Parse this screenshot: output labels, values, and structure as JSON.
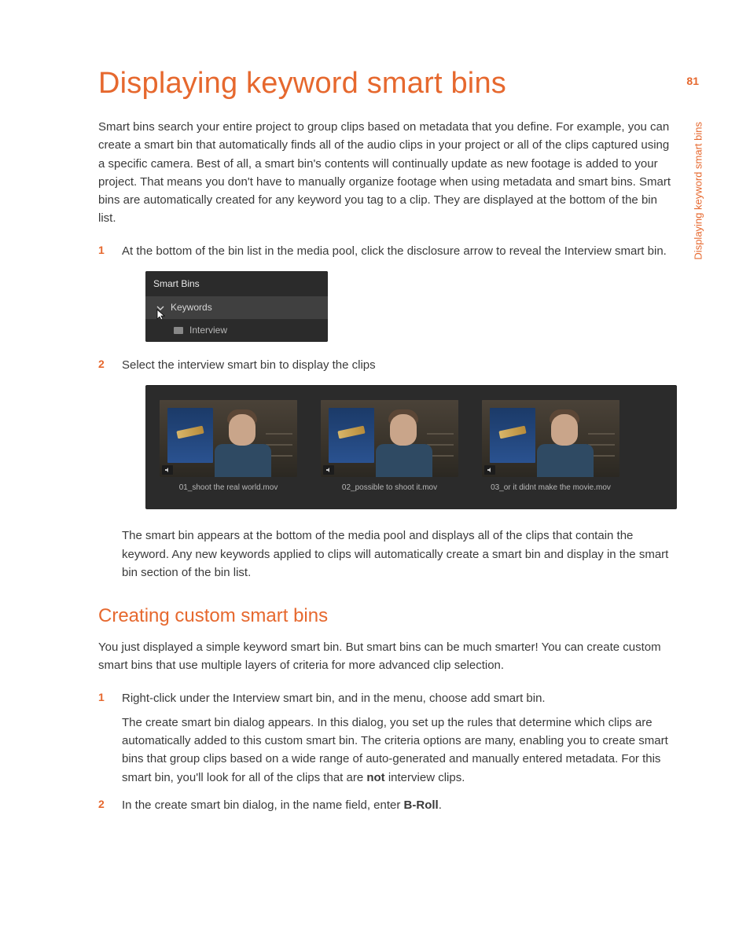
{
  "page_number": "81",
  "side_tab": "Displaying keyword smart bins",
  "heading": "Displaying keyword smart bins",
  "intro": "Smart bins search your entire project to group clips based on metadata that you define. For example, you can create a smart bin that automatically finds all of the audio clips in your project or all of the clips captured using a specific camera. Best of all, a smart bin's contents will continually update as new footage is added to your project. That means you don't have to manually organize footage when using metadata and smart bins. Smart bins are automatically created for any keyword you tag to a clip. They are displayed at the bottom of the bin list.",
  "steps1": {
    "s1_num": "1",
    "s1_text": "At the bottom of the bin list in the media pool, click the disclosure arrow to reveal the Interview smart bin.",
    "s2_num": "2",
    "s2_text": "Select the interview smart bin to display the clips"
  },
  "smartbins": {
    "header": "Smart Bins",
    "parent": "Keywords",
    "child": "Interview"
  },
  "thumbs": {
    "t1": "01_shoot the real world.mov",
    "t2": "02_possible to shoot it.mov",
    "t3": "03_or it didnt make the movie.mov"
  },
  "after_note": "The smart bin appears at the bottom of the media pool and displays all of the clips that contain the keyword. Any new keywords applied to clips will automatically create a smart bin and display in the smart bin section of the bin list.",
  "subheading": "Creating custom smart bins",
  "sub_intro": "You just displayed a simple keyword smart bin. But smart bins can be much smarter! You can create custom smart bins that use multiple layers of criteria for more advanced clip selection.",
  "steps2": {
    "s1_num": "1",
    "s1_text": "Right-click under the Interview smart bin, and in the menu, choose add smart bin.",
    "s1_para_pre": "The create smart bin dialog appears. In this dialog, you set up the rules that determine which clips are automatically added to this custom smart bin. The criteria options are many, enabling you to create smart bins that group clips based on a wide range of auto-generated and manually entered metadata. For this smart bin, you'll look for all of the clips that are ",
    "s1_para_bold": "not",
    "s1_para_post": " interview clips.",
    "s2_num": "2",
    "s2_pre": "In the create smart bin dialog, in the name field, enter ",
    "s2_bold": "B-Roll",
    "s2_post": "."
  }
}
